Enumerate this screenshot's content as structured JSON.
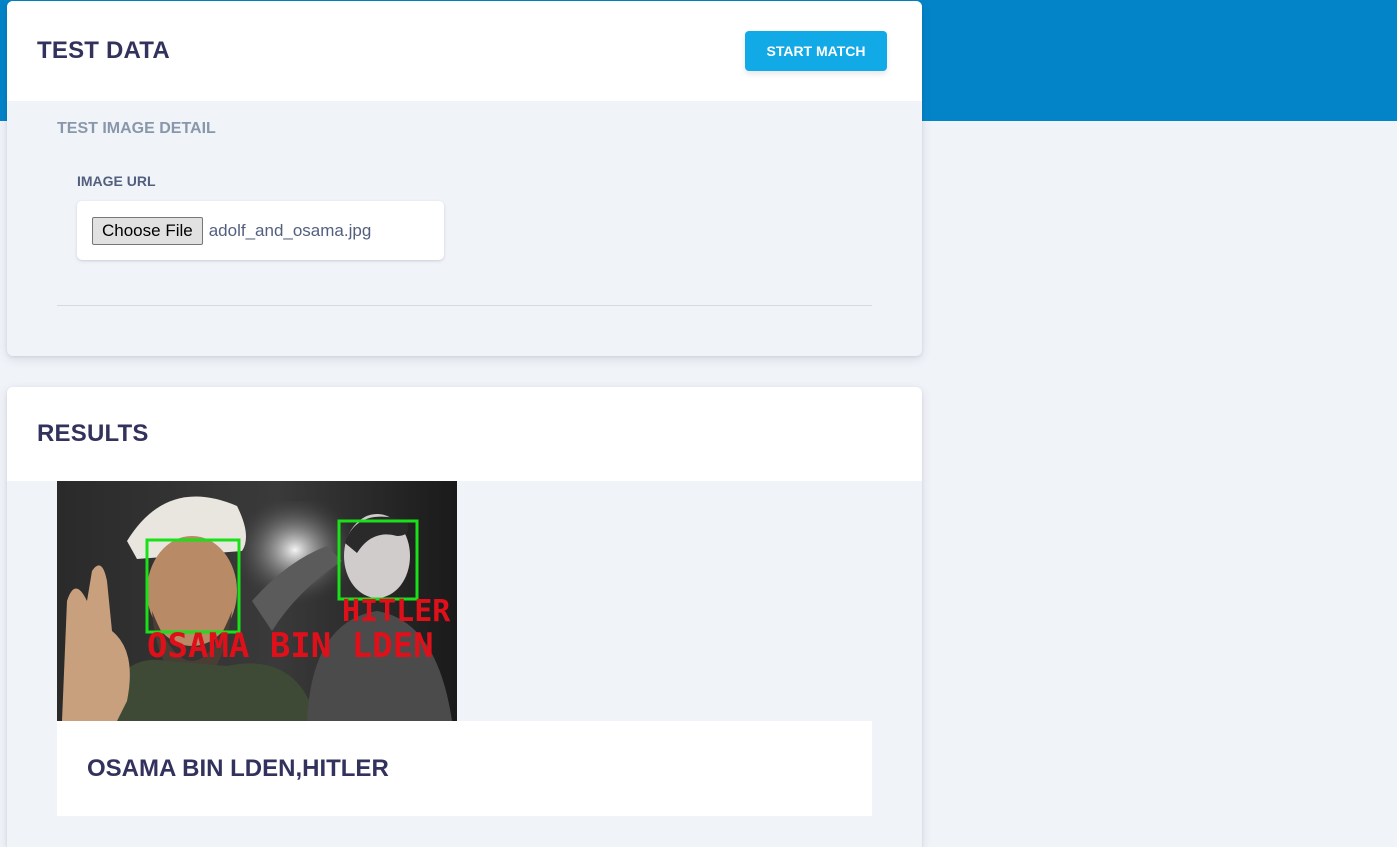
{
  "test_card": {
    "title": "TEST DATA",
    "start_button_label": "START MATCH",
    "section_heading": "TEST IMAGE DETAIL",
    "image_url_label": "IMAGE URL",
    "choose_file_label": "Choose File",
    "selected_file": "adolf_and_osama.jpg"
  },
  "results_card": {
    "title": "RESULTS",
    "image_labels": [
      "OSAMA BIN LDEN",
      "HITLER"
    ],
    "result_text": "OSAMA BIN LDEN,HITLER"
  },
  "colors": {
    "header_band": "#0384c8",
    "start_button": "#11a9e6",
    "detection_box": "#19e019",
    "detection_label": "#e0101a"
  }
}
